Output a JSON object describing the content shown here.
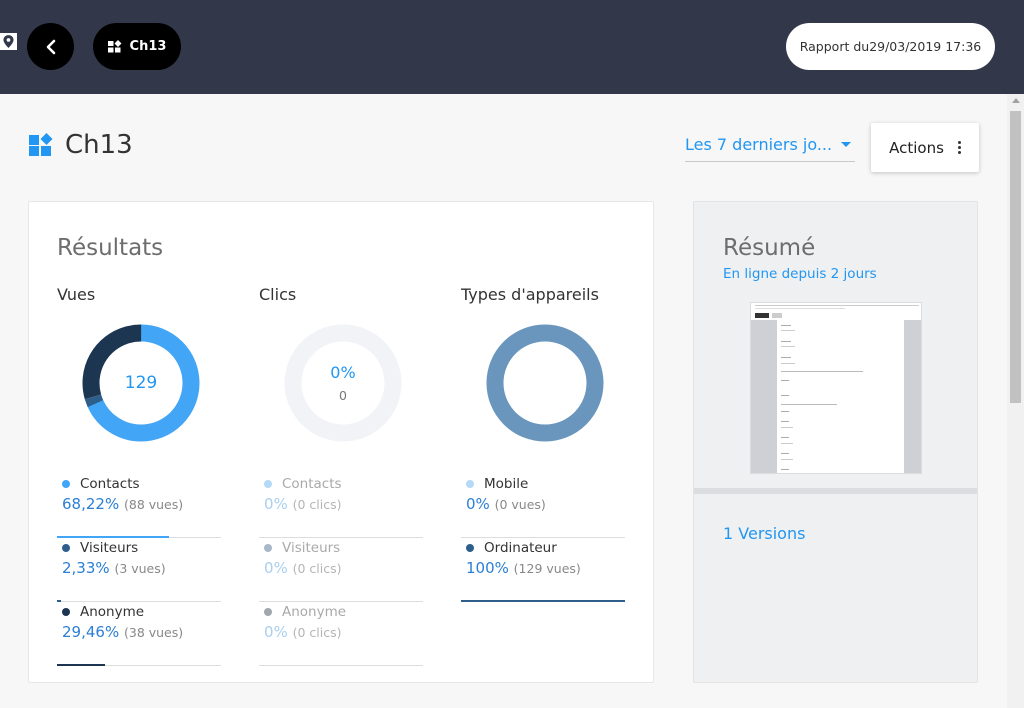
{
  "topbar": {
    "breadcrumb_label": "Ch13",
    "report_label": "Rapport du29/03/2019 17:36"
  },
  "header": {
    "title": "Ch13",
    "period_label": "Les 7 derniers jo...",
    "actions_label": "Actions"
  },
  "results": {
    "title": "Résultats",
    "views": {
      "title": "Vues",
      "center_value": "129",
      "items": [
        {
          "name": "Contacts",
          "percent": "68,22%",
          "detail": "(88 vues)",
          "fraction": 0.6822,
          "color": "#42a5f5"
        },
        {
          "name": "Visiteurs",
          "percent": "2,33%",
          "detail": "(3 vues)",
          "fraction": 0.0233,
          "color": "#2e5f8a"
        },
        {
          "name": "Anonyme",
          "percent": "29,46%",
          "detail": "(38 vues)",
          "fraction": 0.2946,
          "color": "#1c3550"
        }
      ]
    },
    "clicks": {
      "title": "Clics",
      "center_percent": "0%",
      "center_value": "0",
      "items": [
        {
          "name": "Contacts",
          "percent": "0%",
          "detail": "(0 clics)",
          "fraction": 0,
          "color": "#b3d9f7"
        },
        {
          "name": "Visiteurs",
          "percent": "0%",
          "detail": "(0 clics)",
          "fraction": 0,
          "color": "#a8b8c8"
        },
        {
          "name": "Anonyme",
          "percent": "0%",
          "detail": "(0 clics)",
          "fraction": 0,
          "color": "#a1a7ae"
        }
      ]
    },
    "devices": {
      "title": "Types d'appareils",
      "items": [
        {
          "name": "Mobile",
          "percent": "0%",
          "detail": "(0 vues)",
          "fraction": 0,
          "color": "#b3d9f7"
        },
        {
          "name": "Ordinateur",
          "percent": "100%",
          "detail": "(129 vues)",
          "fraction": 1,
          "color": "#2e5f8a"
        }
      ]
    }
  },
  "summary": {
    "title": "Résumé",
    "subtitle": "En ligne depuis 2 jours",
    "versions_label": "1 Versions"
  },
  "colors": {
    "accent": "#2196f3",
    "topbar": "#32374a"
  }
}
